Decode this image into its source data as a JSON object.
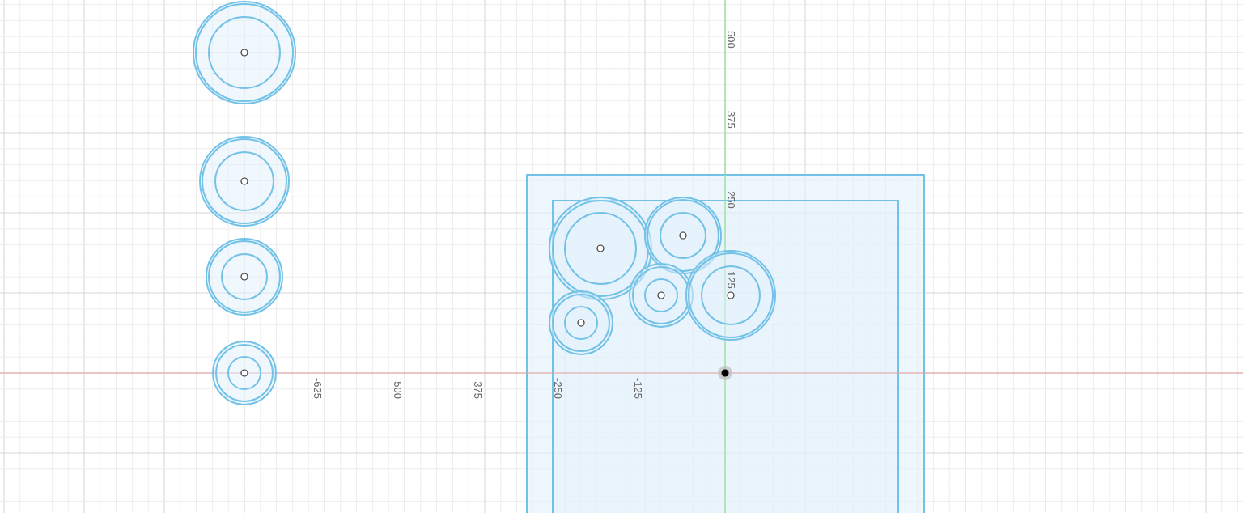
{
  "canvas": {
    "x_axis_labels": [
      "-625",
      "-500",
      "-375",
      "-250",
      "-125"
    ],
    "y_axis_labels": [
      "500",
      "375",
      "250",
      "125"
    ]
  }
}
